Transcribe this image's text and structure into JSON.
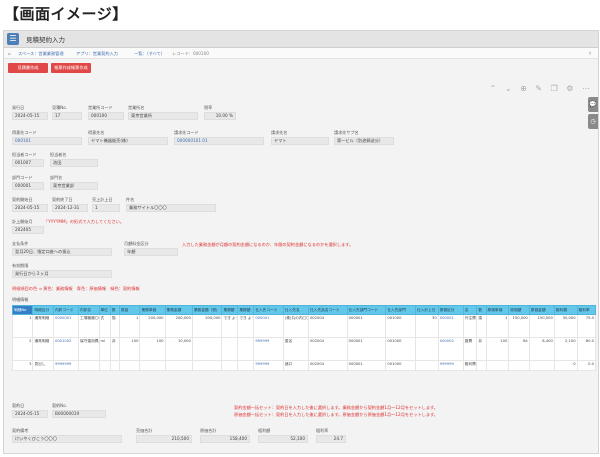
{
  "page_heading": "【画面イメージ】",
  "app": {
    "title": "見積契約入力"
  },
  "breadcrumb": [
    "ホーム",
    "スペース：営業業務管理",
    "アプリ：営業契約入力",
    "一覧：（すべて）",
    "レコード：000100"
  ],
  "buttons": {
    "create": "見積書作成",
    "print": "帳票作成帳票作成"
  },
  "toolbar_icons": [
    "chevron-up-icon",
    "chevron-down-icon",
    "add-icon",
    "edit-icon",
    "copy-icon",
    "gear-icon",
    "more-icon"
  ],
  "side_tabs": [
    "comment-icon",
    "history-icon"
  ],
  "fields": {
    "order_date": {
      "label": "発行日",
      "value": "2024-05-15"
    },
    "order_no": {
      "label": "見積No.",
      "value": "17"
    },
    "office_code": {
      "label": "営業所コード",
      "value": "000100"
    },
    "office_name": {
      "label": "営業所名",
      "value": "東京営業所"
    },
    "tax_rate": {
      "label": "税率",
      "value": "10.00 %"
    },
    "customer_code": {
      "label": "得意先コード",
      "value": "000101"
    },
    "customer_name": {
      "label": "得意先名",
      "value": "ヤマト機器販売(株)"
    },
    "billing_code": {
      "label": "請求先コード",
      "value": "000000101 01"
    },
    "billing_name": {
      "label": "請求先名",
      "value": "ヤマト"
    },
    "billing_sub": {
      "label": "請求先サブ名",
      "value": "第一ビル（別途郵送分）"
    },
    "staff_code": {
      "label": "担当者コード",
      "value": "001007"
    },
    "staff_name": {
      "label": "担当者名",
      "value": "池田"
    },
    "dept_code": {
      "label": "部門コード",
      "value": "000001"
    },
    "dept_name": {
      "label": "部門名",
      "value": "東京営業部"
    },
    "contract_start": {
      "label": "契約開始日",
      "value": "2024-05-15"
    },
    "contract_end": {
      "label": "契約終了日",
      "value": "2024-12-31"
    },
    "sales_total_label": {
      "label": "売上計上日",
      "value": "1"
    },
    "subject": {
      "label": "件名",
      "value": "業務サイトル〇〇〇"
    },
    "billing_month": {
      "label": "計上開始月",
      "value": "202405"
    },
    "billing_month_note": "「YYYYMM」の形式で入力してください。",
    "payment_terms": {
      "label": "支払条件",
      "value": "翌月20日、指定口座への振込"
    },
    "renewal_type": {
      "label": "月額料金区分",
      "value": "年額"
    },
    "renewal_note": "入力した業務金額が月額の契約金額になるのか、年間の契約金額になるのかを選択します。",
    "valid_period": {
      "label": "有効期限",
      "value": "発行日から３ヶ月"
    },
    "color_note": "明細項目の色 ⇒ 黄色：業務情報　青色：原価情報　緑色：契約情報",
    "detail_label": "明細情報"
  },
  "table": {
    "headers": [
      "明細No",
      "明細区分",
      "内訳コード",
      "内訳名",
      "単位",
      "数",
      "数量",
      "業務単価",
      "業務金額",
      "業務金額（税)",
      "業務額（総)",
      "業務額（年)",
      "仕入先コード",
      "仕入先名",
      "仕入先品名コード",
      "仕入先部門コード",
      "仕入先部門",
      "仕入計上日",
      "原価区分",
      "名",
      "数",
      "原価単価",
      "原価額",
      "原価金額",
      "粗利額",
      "粗利率"
    ],
    "rows": [
      [
        "1",
        "通常明細",
        "0000001",
        "工場機器〇〇",
        "式",
        "換",
        "1",
        "200,000",
        "200,000",
        "200,000",
        "でき ようし",
        "でき ようし2",
        "000001",
        "(株)丸の内〇〇工業",
        "002004",
        "000001",
        "001000",
        "30",
        "000001",
        "外注費",
        "換",
        "1",
        "150,000",
        "150,000",
        "50,000",
        "75.0"
      ],
      [
        "2",
        "通常明細",
        "0001002",
        "保守運用費用",
        "ml",
        "弁",
        "100",
        "100",
        "10,000",
        "",
        "",
        "",
        "999999",
        "匿名",
        "002004",
        "000001",
        "001000",
        "",
        "000002",
        "雑費",
        "弁",
        "100",
        "84",
        "8,400",
        "2,100",
        "80.0"
      ],
      [
        "3",
        "見出し",
        "9999999",
        "",
        "",
        "",
        "",
        "",
        "",
        "",
        "",
        "",
        "999999",
        "諸口",
        "002004",
        "000001",
        "001000",
        "",
        "999999",
        "粗利費",
        "",
        "",
        "",
        "",
        "0",
        "0.0"
      ]
    ]
  },
  "footer": {
    "contract_date": {
      "label": "契約日",
      "value": "2024-05-15"
    },
    "contract_no": {
      "label": "契約No.",
      "value": "B00000019"
    },
    "note1": "契約金額一括セット：契約日を入力した後に選択します。業務金額から契約金額1月～12月をセットします。",
    "note2": "原価金額一括セット：契約日を入力した後に選択します。原価金額から原価金額1月～12月をセットします。",
    "remarks": {
      "label": "契約備考",
      "value": "けいやくびこう〇〇〇"
    },
    "total_sales": {
      "label": "売価合計",
      "value": "210,500"
    },
    "total_cost": {
      "label": "原価合計",
      "value": "158,400"
    },
    "gross_profit": {
      "label": "粗利額",
      "value": "52,100"
    },
    "gross_rate": {
      "label": "粗利率",
      "value": "24.7"
    }
  }
}
